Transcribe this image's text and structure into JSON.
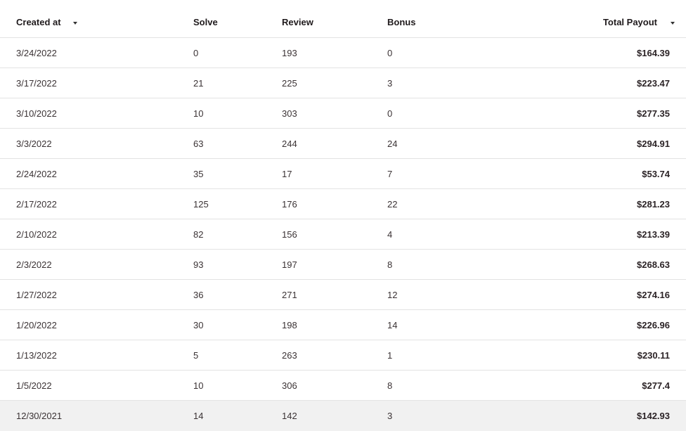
{
  "table": {
    "columns": [
      {
        "label": "Created at",
        "sortable": true,
        "icon": "caret-down-icon"
      },
      {
        "label": "Solve"
      },
      {
        "label": "Review"
      },
      {
        "label": "Bonus"
      },
      {
        "label": "Total Payout",
        "sortable": true,
        "icon": "caret-down-icon"
      }
    ],
    "rows": [
      {
        "created_at": "3/24/2022",
        "solve": "0",
        "review": "193",
        "bonus": "0",
        "total_payout": "$164.39"
      },
      {
        "created_at": "3/17/2022",
        "solve": "21",
        "review": "225",
        "bonus": "3",
        "total_payout": "$223.47"
      },
      {
        "created_at": "3/10/2022",
        "solve": "10",
        "review": "303",
        "bonus": "0",
        "total_payout": "$277.35"
      },
      {
        "created_at": "3/3/2022",
        "solve": "63",
        "review": "244",
        "bonus": "24",
        "total_payout": "$294.91"
      },
      {
        "created_at": "2/24/2022",
        "solve": "35",
        "review": "17",
        "bonus": "7",
        "total_payout": "$53.74"
      },
      {
        "created_at": "2/17/2022",
        "solve": "125",
        "review": "176",
        "bonus": "22",
        "total_payout": "$281.23"
      },
      {
        "created_at": "2/10/2022",
        "solve": "82",
        "review": "156",
        "bonus": "4",
        "total_payout": "$213.39"
      },
      {
        "created_at": "2/3/2022",
        "solve": "93",
        "review": "197",
        "bonus": "8",
        "total_payout": "$268.63"
      },
      {
        "created_at": "1/27/2022",
        "solve": "36",
        "review": "271",
        "bonus": "12",
        "total_payout": "$274.16"
      },
      {
        "created_at": "1/20/2022",
        "solve": "30",
        "review": "198",
        "bonus": "14",
        "total_payout": "$226.96"
      },
      {
        "created_at": "1/13/2022",
        "solve": "5",
        "review": "263",
        "bonus": "1",
        "total_payout": "$230.11"
      },
      {
        "created_at": "1/5/2022",
        "solve": "10",
        "review": "306",
        "bonus": "8",
        "total_payout": "$277.4"
      },
      {
        "created_at": "12/30/2021",
        "solve": "14",
        "review": "142",
        "bonus": "3",
        "total_payout": "$142.93",
        "highlighted": true
      }
    ]
  },
  "colors": {
    "divider": "#e3e3e3",
    "highlight_row": "#f1f1f1",
    "text": "#2b2326"
  }
}
